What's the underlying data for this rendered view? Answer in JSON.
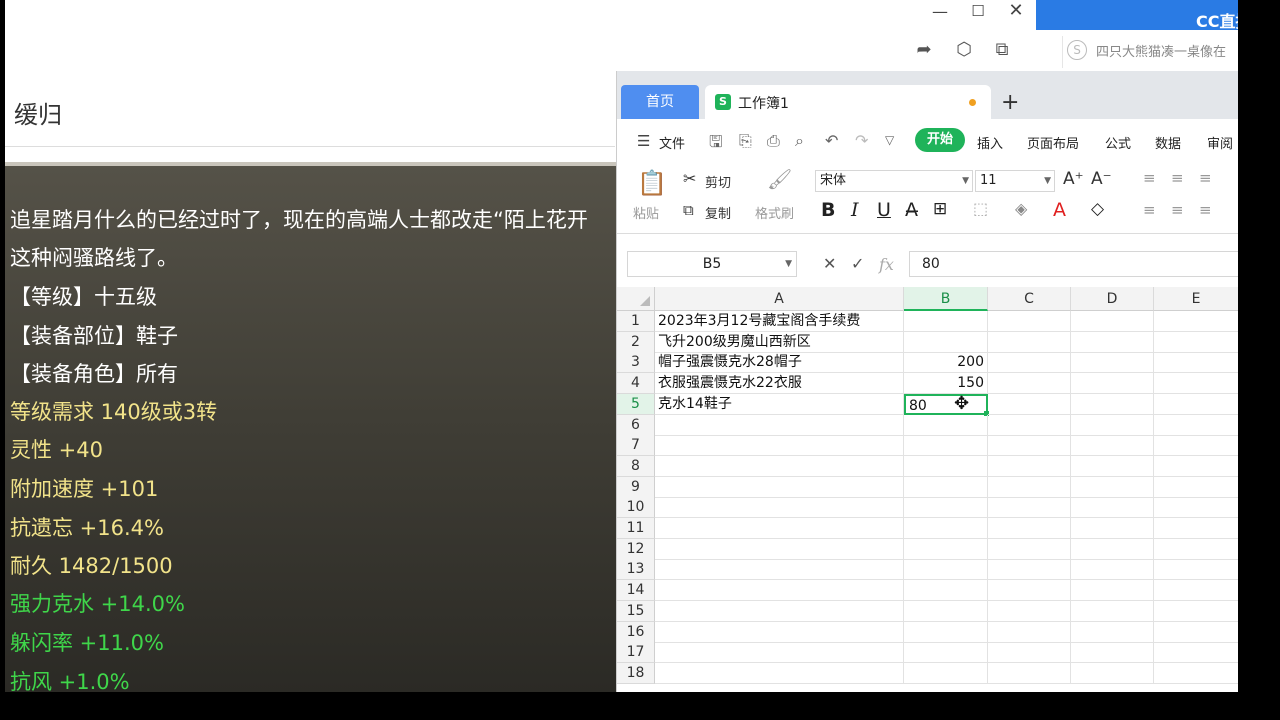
{
  "window": {
    "minimize": "—",
    "maximize": "☐",
    "close": "✕"
  },
  "watermark": "CC直播",
  "browser": {
    "side_search_text": "四只大熊猫凑一桌像在"
  },
  "article": {
    "title": "缓归",
    "lines": [
      {
        "text": "追星踏月什么的已经过时了，现在的高端人士都改走“陌上花开",
        "color": "white"
      },
      {
        "text": "这种闷骚路线了。",
        "color": "white"
      },
      {
        "text": "【等级】十五级",
        "color": "white"
      },
      {
        "text": "【装备部位】鞋子",
        "color": "white"
      },
      {
        "text": "【装备角色】所有",
        "color": "white"
      },
      {
        "text": "等级需求 140级或3转",
        "color": "yellow"
      },
      {
        "text": "灵性 +40",
        "color": "yellow"
      },
      {
        "text": "附加速度 +101",
        "color": "yellow"
      },
      {
        "text": "抗遗忘 +16.4%",
        "color": "yellow"
      },
      {
        "text": "耐久 1482/1500",
        "color": "yellow"
      },
      {
        "text": "强力克水 +14.0%",
        "color": "green"
      },
      {
        "text": "躲闪率 +11.0%",
        "color": "green"
      },
      {
        "text": "抗风 +1.0%",
        "color": "green"
      }
    ]
  },
  "spreadsheet": {
    "tabs": {
      "home": "首页",
      "workbook": "工作簿1",
      "workbook_icon": "S",
      "add": "+"
    },
    "menu": {
      "file": "文件",
      "start": "开始",
      "items": [
        "插入",
        "页面布局",
        "公式",
        "数据",
        "审阅"
      ]
    },
    "ribbon": {
      "paste": "粘贴",
      "cut": "剪切",
      "copy": "复制",
      "format_painter": "格式刷",
      "font_name": "宋体",
      "font_size": "11",
      "bold": "B",
      "italic": "I",
      "underline": "U"
    },
    "formula_bar": {
      "name_box": "B5",
      "fx": "fx",
      "value": "80"
    },
    "columns": [
      "A",
      "B",
      "C",
      "D",
      "E"
    ],
    "selected_column": "B",
    "rows": [
      "1",
      "2",
      "3",
      "4",
      "5",
      "6",
      "7",
      "8",
      "9",
      "10",
      "11",
      "12",
      "13",
      "14",
      "15",
      "16",
      "17",
      "18"
    ],
    "selected_row": "5",
    "cells": {
      "A1": "2023年3月12号藏宝阁含手续费",
      "A2": "飞升200级男魔山西新区",
      "A3": "帽子强震慑克水28帽子",
      "B3": "200",
      "A4": "衣服强震慑克水22衣服",
      "B4": "150",
      "A5": "克水14鞋子",
      "B5": "80"
    },
    "active_cell": "B5"
  }
}
